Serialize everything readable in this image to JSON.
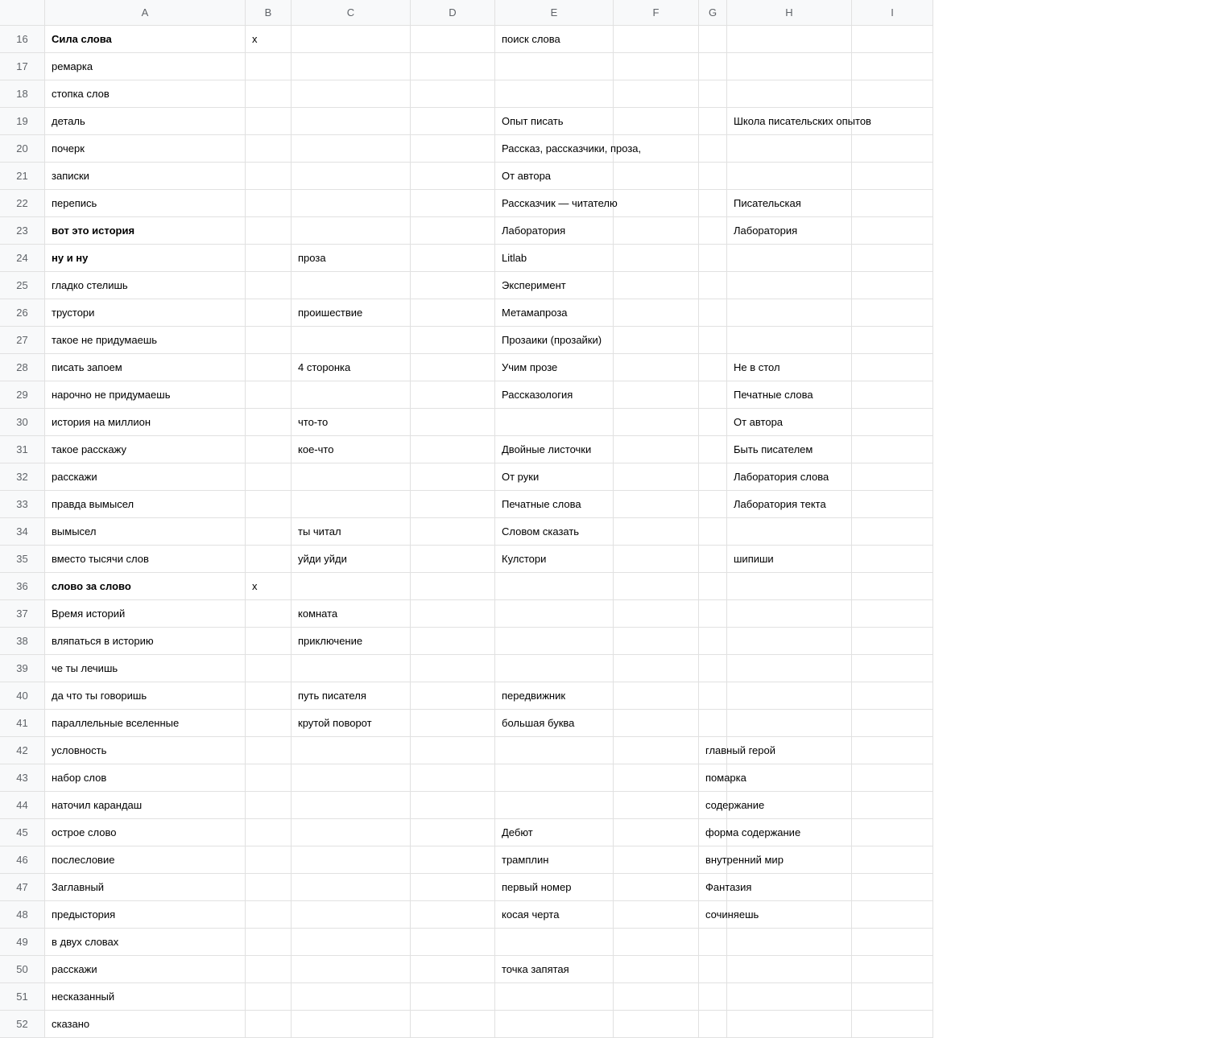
{
  "columns": [
    "A",
    "B",
    "C",
    "D",
    "E",
    "F",
    "G",
    "H",
    "I"
  ],
  "rows": [
    {
      "num": 16,
      "bold": true,
      "A": "Сила слова",
      "B": "х",
      "C": "",
      "D": "",
      "E": "поиск слова",
      "F": "",
      "G": "",
      "H": "",
      "I": ""
    },
    {
      "num": 17,
      "bold": false,
      "A": "ремарка",
      "B": "",
      "C": "",
      "D": "",
      "E": "",
      "F": "",
      "G": "",
      "H": "",
      "I": ""
    },
    {
      "num": 18,
      "bold": false,
      "A": "стопка слов",
      "B": "",
      "C": "",
      "D": "",
      "E": "",
      "F": "",
      "G": "",
      "H": "",
      "I": ""
    },
    {
      "num": 19,
      "bold": false,
      "A": "деталь",
      "B": "",
      "C": "",
      "D": "",
      "E": "Опыт писать",
      "F": "",
      "G": "",
      "H": "Школа писательских опытов",
      "I": ""
    },
    {
      "num": 20,
      "bold": false,
      "A": "почерк",
      "B": "",
      "C": "",
      "D": "",
      "E": "Рассказ, рассказчики, проза,",
      "F": "",
      "G": "",
      "H": "",
      "I": ""
    },
    {
      "num": 21,
      "bold": false,
      "A": "записки",
      "B": "",
      "C": "",
      "D": "",
      "E": "От автора",
      "F": "",
      "G": "",
      "H": "",
      "I": ""
    },
    {
      "num": 22,
      "bold": false,
      "A": "перепись",
      "B": "",
      "C": "",
      "D": "",
      "E": "Рассказчик — читателю",
      "F": "",
      "G": "",
      "H": "Писательская",
      "I": ""
    },
    {
      "num": 23,
      "bold": true,
      "A": "вот это история",
      "B": "",
      "C": "",
      "D": "",
      "E": "Лаборатория",
      "F": "",
      "G": "",
      "H": "Лаборатория",
      "I": ""
    },
    {
      "num": 24,
      "bold": true,
      "A": "ну и ну",
      "B": "",
      "C": "проза",
      "D": "",
      "E": "Litlab",
      "F": "",
      "G": "",
      "H": "",
      "I": ""
    },
    {
      "num": 25,
      "bold": false,
      "A": "гладко стелишь",
      "B": "",
      "C": "",
      "D": "",
      "E": "Эксперимент",
      "F": "",
      "G": "",
      "H": "",
      "I": ""
    },
    {
      "num": 26,
      "bold": false,
      "A": "трустори",
      "B": "",
      "C": "проишествие",
      "D": "",
      "E": "Метамапроза",
      "F": "",
      "G": "",
      "H": "",
      "I": ""
    },
    {
      "num": 27,
      "bold": false,
      "A": "такое не придумаешь",
      "B": "",
      "C": "",
      "D": "",
      "E": "Прозаики (прозайки)",
      "F": "",
      "G": "",
      "H": "",
      "I": ""
    },
    {
      "num": 28,
      "bold": false,
      "A": "писать запоем",
      "B": "",
      "C": "4 сторонка",
      "D": "",
      "E": "Учим прозе",
      "F": "",
      "G": "",
      "H": "Не в стол",
      "I": ""
    },
    {
      "num": 29,
      "bold": false,
      "A": "нарочно не придумаешь",
      "B": "",
      "C": "",
      "D": "",
      "E": "Рассказология",
      "F": "",
      "G": "",
      "H": "Печатные слова",
      "I": ""
    },
    {
      "num": 30,
      "bold": false,
      "A": "история на миллион",
      "B": "",
      "C": "что-то",
      "D": "",
      "E": "",
      "F": "",
      "G": "",
      "H": "От автора",
      "I": ""
    },
    {
      "num": 31,
      "bold": false,
      "A": "такое расскажу",
      "B": "",
      "C": "кое-что",
      "D": "",
      "E": "Двойные листочки",
      "F": "",
      "G": "",
      "H": "Быть писателем",
      "I": ""
    },
    {
      "num": 32,
      "bold": false,
      "A": "расскажи",
      "B": "",
      "C": "",
      "D": "",
      "E": "От руки",
      "F": "",
      "G": "",
      "H": "Лаборатория слова",
      "I": ""
    },
    {
      "num": 33,
      "bold": false,
      "A": "правда вымысел",
      "B": "",
      "C": "",
      "D": "",
      "E": "Печатные слова",
      "F": "",
      "G": "",
      "H": "Лаборатория текта",
      "I": ""
    },
    {
      "num": 34,
      "bold": false,
      "A": "вымысел",
      "B": "",
      "C": "ты читал",
      "D": "",
      "E": "Словом сказать",
      "F": "",
      "G": "",
      "H": "",
      "I": ""
    },
    {
      "num": 35,
      "bold": false,
      "A": "вместо тысячи слов",
      "B": "",
      "C": "уйди уйди",
      "D": "",
      "E": "Кулстори",
      "F": "",
      "G": "",
      "H": "шипиши",
      "I": ""
    },
    {
      "num": 36,
      "bold": true,
      "A": "слово за слово",
      "B": "х",
      "C": "",
      "D": "",
      "E": "",
      "F": "",
      "G": "",
      "H": "",
      "I": ""
    },
    {
      "num": 37,
      "bold": false,
      "A": "Время историй",
      "B": "",
      "C": "комната",
      "D": "",
      "E": "",
      "F": "",
      "G": "",
      "H": "",
      "I": ""
    },
    {
      "num": 38,
      "bold": false,
      "A": "вляпаться в историю",
      "B": "",
      "C": "приключение",
      "D": "",
      "E": "",
      "F": "",
      "G": "",
      "H": "",
      "I": ""
    },
    {
      "num": 39,
      "bold": false,
      "A": "че ты лечишь",
      "B": "",
      "C": "",
      "D": "",
      "E": "",
      "F": "",
      "G": "",
      "H": "",
      "I": ""
    },
    {
      "num": 40,
      "bold": false,
      "A": "да что ты говоришь",
      "B": "",
      "C": "путь писателя",
      "D": "",
      "E": "передвижник",
      "F": "",
      "G": "",
      "H": "",
      "I": ""
    },
    {
      "num": 41,
      "bold": false,
      "A": "параллельные вселенные",
      "B": "",
      "C": "крутой поворот",
      "D": "",
      "E": "большая буква",
      "F": "",
      "G": "",
      "H": "",
      "I": ""
    },
    {
      "num": 42,
      "bold": false,
      "A": "условность",
      "B": "",
      "C": "",
      "D": "",
      "E": "",
      "F": "",
      "G": "главный герой",
      "H": "",
      "I": ""
    },
    {
      "num": 43,
      "bold": false,
      "A": "набор слов",
      "B": "",
      "C": "",
      "D": "",
      "E": "",
      "F": "",
      "G": "помарка",
      "H": "",
      "I": ""
    },
    {
      "num": 44,
      "bold": false,
      "A": "наточил карандаш",
      "B": "",
      "C": "",
      "D": "",
      "E": "",
      "F": "",
      "G": "содержание",
      "H": "",
      "I": ""
    },
    {
      "num": 45,
      "bold": false,
      "A": "острое слово",
      "B": "",
      "C": "",
      "D": "",
      "E": "Дебют",
      "F": "",
      "G": "форма содержание",
      "H": "",
      "I": ""
    },
    {
      "num": 46,
      "bold": false,
      "A": "послесловие",
      "B": "",
      "C": "",
      "D": "",
      "E": "трамплин",
      "F": "",
      "G": "внутренний мир",
      "H": "",
      "I": ""
    },
    {
      "num": 47,
      "bold": false,
      "A": "Заглавный",
      "B": "",
      "C": "",
      "D": "",
      "E": "первый номер",
      "F": "",
      "G": "Фантазия",
      "H": "",
      "I": ""
    },
    {
      "num": 48,
      "bold": false,
      "A": "предыстория",
      "B": "",
      "C": "",
      "D": "",
      "E": "косая черта",
      "F": "",
      "G": "сочиняешь",
      "H": "",
      "I": ""
    },
    {
      "num": 49,
      "bold": false,
      "A": "в двух словах",
      "B": "",
      "C": "",
      "D": "",
      "E": "",
      "F": "",
      "G": "",
      "H": "",
      "I": ""
    },
    {
      "num": 50,
      "bold": false,
      "A": "расскажи",
      "B": "",
      "C": "",
      "D": "",
      "E": "точка запятая",
      "F": "",
      "G": "",
      "H": "",
      "I": ""
    },
    {
      "num": 51,
      "bold": false,
      "A": "несказанный",
      "B": "",
      "C": "",
      "D": "",
      "E": "",
      "F": "",
      "G": "",
      "H": "",
      "I": ""
    },
    {
      "num": 52,
      "bold": false,
      "A": "сказано",
      "B": "",
      "C": "",
      "D": "",
      "E": "",
      "F": "",
      "G": "",
      "H": "",
      "I": ""
    }
  ]
}
